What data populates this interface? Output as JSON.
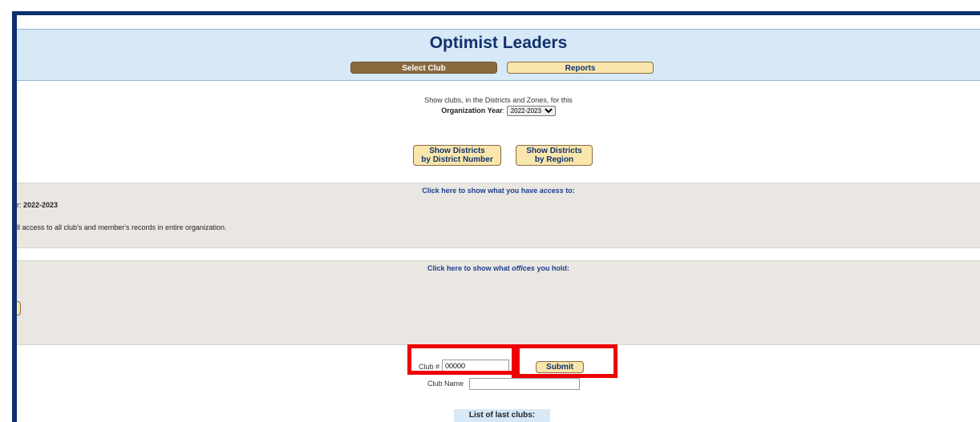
{
  "app": {
    "title": "Optimist Leaders"
  },
  "nav": {
    "select_club": "Select Club",
    "reports": "Reports"
  },
  "intro": {
    "line1": "Show clubs, in the Districts and Zones, for this",
    "year_label": "Organization Year",
    "year_separator": ":",
    "year_value": "2022-2023"
  },
  "buttons": {
    "by_number_line1": "Show Districts",
    "by_number_line2": "by District Number",
    "by_region_line1": "Show Districts",
    "by_region_line2": "by Region"
  },
  "access_panel": {
    "link_prefix": "Click here to show what you have ",
    "link_emphasis": "access",
    "link_suffix": " to:",
    "year_partial_label": "r: ",
    "year_value": "2022-2023",
    "description": "ll access to all club's and member's records in entire organization."
  },
  "offices_panel": {
    "link_prefix": "Click here to show what ",
    "link_emphasis": "offices",
    "link_suffix": " you hold:"
  },
  "club_search": {
    "club_number_label": "Club #",
    "club_number_value": "00000",
    "club_name_label": "Club Name",
    "club_name_value": "",
    "submit_label": "Submit"
  },
  "last_clubs": {
    "label": "List of last clubs:"
  },
  "colors": {
    "frame": "#0d2f6c",
    "title_text": "#12316e",
    "header_bg": "#d7e8f6",
    "active_tab": "#8b6a3d",
    "tan_button": "#f8e6ac",
    "panel_bg": "#eae7e2",
    "link": "#1f3f8f",
    "highlight": "#ee0000"
  }
}
